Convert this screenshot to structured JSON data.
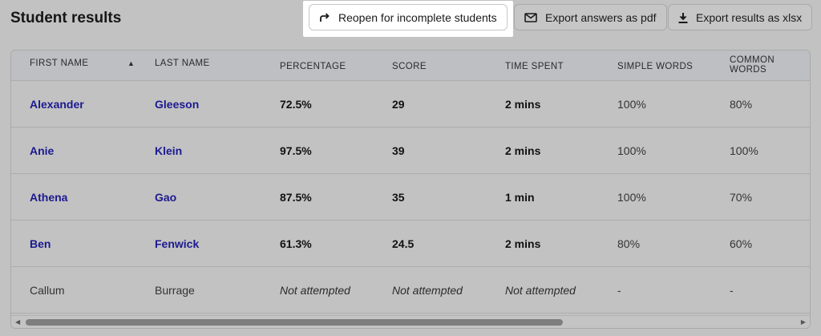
{
  "page": {
    "title": "Student results"
  },
  "toolbar": {
    "reopen_label": "Reopen for incomplete students",
    "pdf_label": "Export answers as pdf",
    "xlsx_label": "Export results as xlsx"
  },
  "icons": {
    "reopen": "redo-arrow-icon",
    "pdf": "mail-icon",
    "xlsx": "download-icon",
    "sort": "sort-ascending-icon"
  },
  "table": {
    "headers": {
      "first_name": "FIRST NAME",
      "last_name": "LAST NAME",
      "percentage": "PERCENTAGE",
      "score": "SCORE",
      "time_spent": "TIME SPENT",
      "simple_words": "SIMPLE WORDS",
      "common_words": "COMMON WORDS"
    },
    "sort_indicator": "▲",
    "rows": [
      {
        "first": "Alexander",
        "last": "Gleeson",
        "percentage": "72.5%",
        "score": "29",
        "time": "2 mins",
        "simple": "100%",
        "common": "80%"
      },
      {
        "first": "Anie",
        "last": "Klein",
        "percentage": "97.5%",
        "score": "39",
        "time": "2 mins",
        "simple": "100%",
        "common": "100%"
      },
      {
        "first": "Athena",
        "last": "Gao",
        "percentage": "87.5%",
        "score": "35",
        "time": "1 min",
        "simple": "100%",
        "common": "70%"
      },
      {
        "first": "Ben",
        "last": "Fenwick",
        "percentage": "61.3%",
        "score": "24.5",
        "time": "2 mins",
        "simple": "80%",
        "common": "60%"
      },
      {
        "first": "Callum",
        "last": "Burrage",
        "percentage": "Not attempted",
        "score": "Not attempted",
        "time": "Not attempted",
        "simple": "-",
        "common": "-"
      }
    ]
  },
  "colors": {
    "link": "#1c1a8f",
    "highlight": "#ffffff",
    "overlay": "#c2c2c2"
  }
}
